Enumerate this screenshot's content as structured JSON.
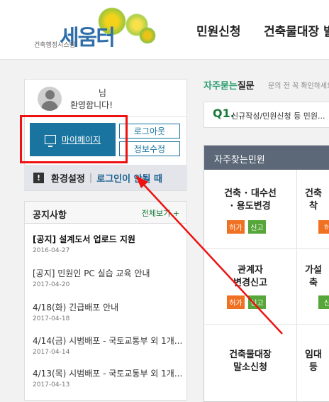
{
  "header": {
    "logo_text": "세움터",
    "logo_sub": "건축행정시스템",
    "nav": [
      "민원신청",
      "건축물대장 발급"
    ]
  },
  "user": {
    "suffix": "님",
    "welcome": "환영합니다!",
    "mypage_label": "마이페이지",
    "logout_label": "로그아웃",
    "info_label": "정보수정"
  },
  "settings": {
    "label": "환경설정",
    "separator": "|",
    "login_help": "로그인이 안될 때"
  },
  "notice": {
    "title": "공지사항",
    "more": "전체보기 +",
    "items": [
      {
        "title": "[공지] 설계도서 업로드 지원",
        "date": "2016-04-27"
      },
      {
        "title": "[공지] 민원인 PC 실습 교육 안내",
        "date": "2017-04-20"
      },
      {
        "title": "4/18(화) 긴급배포 안내",
        "date": "2017-04-18"
      },
      {
        "title": "4/14(금) 시범배포 - 국토교통부 외 1개...",
        "date": "2017-04-14"
      },
      {
        "title": "4/13(목) 시범배포 - 국토교통부 외 1개...",
        "date": "2017-04-13"
      }
    ]
  },
  "faq": {
    "title_highlight": "자주묻는",
    "title_rest": "질문",
    "subtitle": "문의 전 꼭 확인하세요",
    "q_label": "Q1.",
    "q_text": "신규작성/민원신청 등 민원..."
  },
  "frequent": {
    "title": "자주찾는민원",
    "cells": [
      {
        "title_line1": "건축 · 대수선",
        "title_line2": "· 용도변경",
        "tag1": "허가",
        "tag2": "신고"
      },
      {
        "title_line1": "건축",
        "title_line2": "착",
        "tag1": "허"
      },
      {
        "title_line1": "관계자",
        "title_line2": "변경신고",
        "tag1": "허가",
        "tag2": "신고"
      },
      {
        "title_line1": "가설",
        "title_line2": "축",
        "tag1": "신"
      },
      {
        "title_line1": "건축물대장",
        "title_line2": "말소신청"
      },
      {
        "title_line1": "임대",
        "title_line2": "등"
      }
    ]
  },
  "colors": {
    "primary_blue": "#1a74a0",
    "highlight_red": "#e11111",
    "faq_green": "#2a9d6e",
    "tag_orange": "#f07122",
    "tag_green": "#56a63a"
  }
}
